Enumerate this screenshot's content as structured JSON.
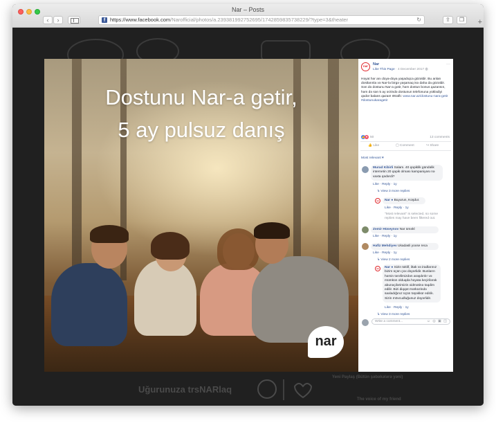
{
  "window": {
    "title": "Nar – Posts",
    "url_host": "https://www.facebook.com",
    "url_path": "/Narofficial/photos/a.239381992752695/1742859835738229/?type=3&theater"
  },
  "photo": {
    "headline_1": "Dostunu Nar-a gətir,",
    "headline_2": "5 ay pulsuz danış",
    "logo_text": "nar"
  },
  "background": {
    "text_left": "Uğurunuza trsNARlaq",
    "text_right_1": "Yeni Paylaş (Bütün şəbəkələrə yəni)",
    "text_right_2": "The voice of my friend"
  },
  "post": {
    "page_name": "Nar",
    "like_page": "Like This Page",
    "date": "4 December 2017",
    "body": "Həyat hər anı doya-doya yaşadıqca gözəldir. Bu anları dostlarınla və Nar-la birgə yaşamaq isə daha da gözəldir. Sən də dostunu Nar-a gətir, həm dostun bonus qazansın, həm də sən 5 ay ərzində dostunun telefonuna yüklədiyi qədər balans qazan! Ətraflı:",
    "link": "www.nar.az/dostunu-nara-getir",
    "hashtag": "#dostunukaragetir",
    "reaction_count": "50",
    "comments_count": "13 comments",
    "like_label": "Like",
    "comment_label": "Comment",
    "share_label": "Share",
    "sort_label": "Most relevant ▾",
    "write_placeholder": "Write a comment..."
  },
  "comments": [
    {
      "author": "Murad Kibirli",
      "text": "Salam. 40 qəpiklik gündəlik internetin 20 qəpik olması kampaniyası nə vaxta qədərdi?",
      "actions": "Like · Reply · 1y",
      "more": "View 3 more replies"
    },
    {
      "author": "Nar",
      "text": "Buyurun, Koşdur.",
      "actions": "Like · Reply · 1y",
      "filter_note": "\"Most relevant\" is selected, so some replies may have been filtered out."
    },
    {
      "author": "Zəmir Hüseynov",
      "text": "Nar üməkl",
      "actions": "Like · Reply · 1y"
    },
    {
      "author": "Hafiz Mehdiyev",
      "text": "Ukadasli yoxse reca",
      "actions": "Like · Reply · 1y",
      "more": "View 2 more replies"
    },
    {
      "author": "Nar",
      "text": "Sizin təklif, iltak və iradlarınız bizim üçün çox dəyərlidir. Bunların həmin tərəfimizdən araşdırılır və mümkün olduqda həyata keçirilərək abunəçilərimizin xidmətinə təqdim edilir. Bizi diqqət mərkəzində saxladığınız üçün təşəkkür edirik. Sizin mövcudluğunuz dəyərlidir.",
      "actions": "Like · Reply · 1y",
      "more": "View 3 more replies"
    }
  ],
  "colors": {
    "facebook_blue": "#365899",
    "nar_red": "#e0262a"
  }
}
